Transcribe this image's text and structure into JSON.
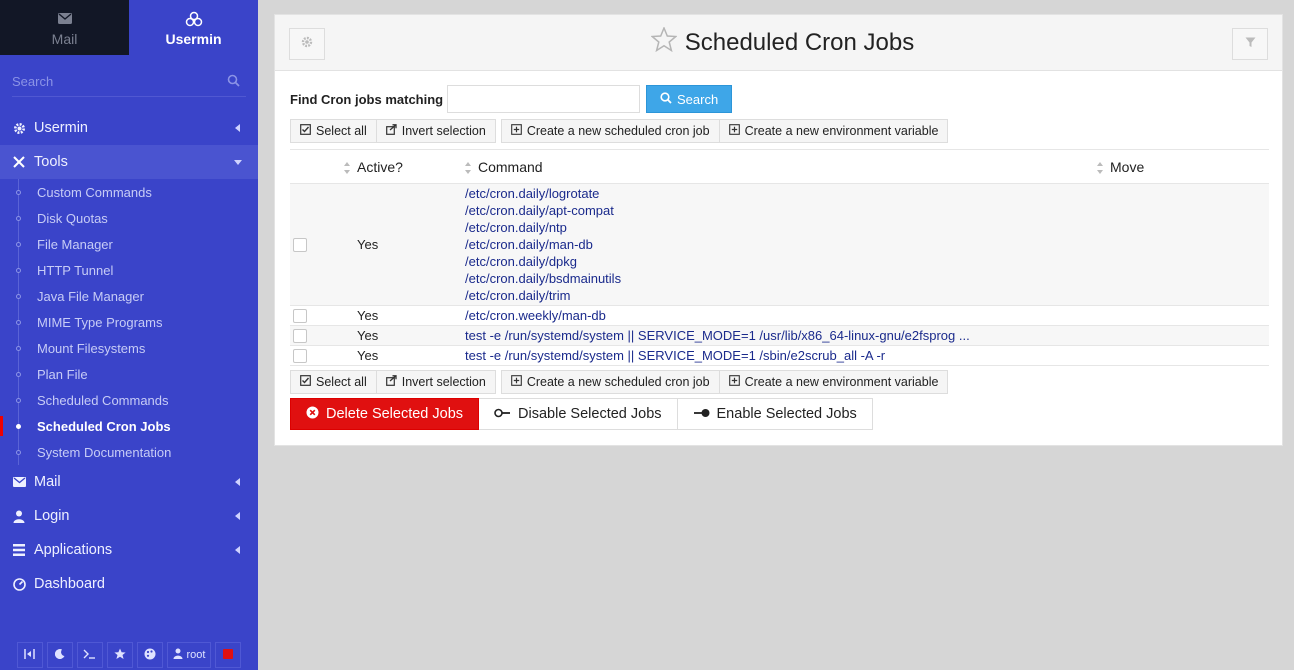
{
  "sidebar": {
    "switch": {
      "mail_label": "Mail",
      "usermin_label": "Usermin"
    },
    "search_placeholder": "Search",
    "menu": {
      "usermin": "Usermin",
      "tools": "Tools",
      "mail": "Mail",
      "login": "Login",
      "applications": "Applications",
      "dashboard": "Dashboard"
    },
    "tools_items": [
      "Custom Commands",
      "Disk Quotas",
      "File Manager",
      "HTTP Tunnel",
      "Java File Manager",
      "MIME Type Programs",
      "Mount Filesystems",
      "Plan File",
      "Scheduled Commands",
      "Scheduled Cron Jobs",
      "System Documentation"
    ],
    "active_item": "Scheduled Cron Jobs",
    "user": "root"
  },
  "page": {
    "title": "Scheduled Cron Jobs",
    "find_label": "Find Cron jobs matching",
    "find_value": "",
    "search_button": "Search",
    "select_all": "Select all",
    "invert_selection": "Invert selection",
    "create_job": "Create a new scheduled cron job",
    "create_env": "Create a new environment variable",
    "delete_button": "Delete Selected Jobs",
    "disable_button": "Disable Selected Jobs",
    "enable_button": "Enable Selected Jobs"
  },
  "table": {
    "headers": {
      "active": "Active?",
      "command": "Command",
      "move": "Move"
    },
    "rows": [
      {
        "active": "Yes",
        "commands": [
          "/etc/cron.daily/logrotate",
          "/etc/cron.daily/apt-compat",
          "/etc/cron.daily/ntp",
          "/etc/cron.daily/man-db",
          "/etc/cron.daily/dpkg",
          "/etc/cron.daily/bsdmainutils",
          "/etc/cron.daily/trim"
        ]
      },
      {
        "active": "Yes",
        "commands": [
          "/etc/cron.weekly/man-db"
        ]
      },
      {
        "active": "Yes",
        "commands": [
          "test -e /run/systemd/system || SERVICE_MODE=1 /usr/lib/x86_64-linux-gnu/e2fsprog ..."
        ]
      },
      {
        "active": "Yes",
        "commands": [
          "test -e /run/systemd/system || SERVICE_MODE=1 /sbin/e2scrub_all -A -r"
        ]
      }
    ]
  },
  "colors": {
    "sidebar": "#3a44c9",
    "danger": "#e01010",
    "primary": "#3ea6e8",
    "link": "#1a2a8c"
  }
}
